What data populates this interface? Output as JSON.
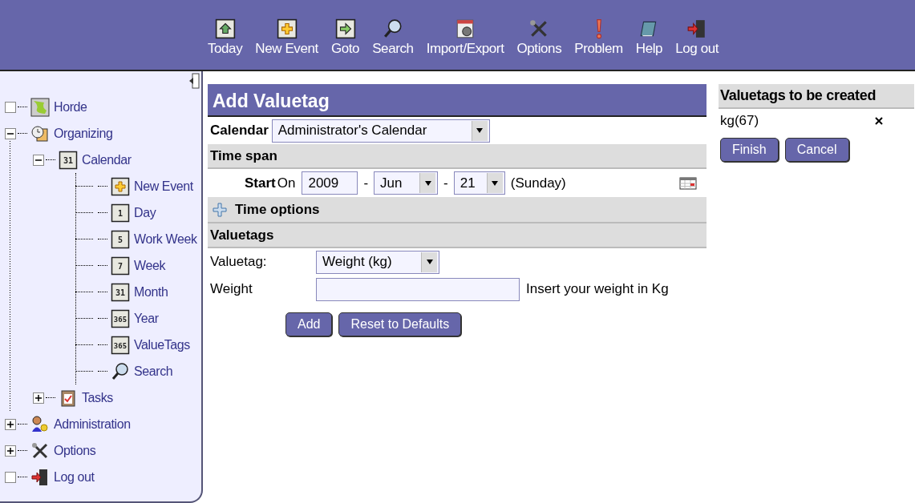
{
  "toolbar": [
    {
      "label": "Today",
      "kind": "today"
    },
    {
      "label": "New Event",
      "kind": "new"
    },
    {
      "label": "Goto",
      "kind": "goto"
    },
    {
      "label": "Search",
      "kind": "search"
    },
    {
      "label": "Import/Export",
      "kind": "import"
    },
    {
      "label": "Options",
      "kind": "options"
    },
    {
      "label": "Problem",
      "kind": "problem"
    },
    {
      "label": "Help",
      "kind": "help"
    },
    {
      "label": "Log out",
      "kind": "logout"
    }
  ],
  "sidebar": {
    "items": [
      {
        "label": "Horde",
        "kind": "horde"
      },
      {
        "label": "Organizing",
        "kind": "organizing",
        "expanded": true,
        "children": [
          {
            "label": "Calendar",
            "kind": "calendar",
            "icon_text": "31",
            "expanded": true,
            "children": [
              {
                "label": "New Event",
                "kind": "new"
              },
              {
                "label": "Day",
                "kind": "calendar",
                "icon_text": "1"
              },
              {
                "label": "Work Week",
                "kind": "calendar",
                "icon_text": "5"
              },
              {
                "label": "Week",
                "kind": "calendar",
                "icon_text": "7"
              },
              {
                "label": "Month",
                "kind": "calendar",
                "icon_text": "31"
              },
              {
                "label": "Year",
                "kind": "calendar",
                "icon_text": "365"
              },
              {
                "label": "ValueTags",
                "kind": "calendar",
                "icon_text": "365"
              },
              {
                "label": "Search",
                "kind": "search"
              }
            ]
          },
          {
            "label": "Tasks",
            "kind": "tasks",
            "expanded": false
          }
        ]
      },
      {
        "label": "Administration",
        "kind": "admin",
        "expanded": false
      },
      {
        "label": "Options",
        "kind": "options",
        "expanded": false
      },
      {
        "label": "Log out",
        "kind": "logout"
      }
    ]
  },
  "form": {
    "title": "Add Valuetag",
    "calendar": {
      "label": "Calendar",
      "value": "Administrator's Calendar"
    },
    "time_span": {
      "title": "Time span",
      "start_label": "Start",
      "on_label": "On",
      "year": "2009",
      "separator_1": "-",
      "month": "Jun",
      "separator_2": "-",
      "day": "21",
      "weekday": "(Sunday)"
    },
    "time_options": {
      "title": "Time options",
      "expanded": false
    },
    "valuetags": {
      "title": "Valuetags",
      "valuetag_label": "Valuetag:",
      "valuetag_value": "Weight (kg)",
      "weight_label": "Weight",
      "weight_hint": "Insert your weight in Kg"
    },
    "buttons": [
      "Add",
      "Reset to Defaults"
    ]
  },
  "pending": {
    "title": "Valuetags to be created",
    "items": [
      {
        "label": "kg(67)"
      }
    ],
    "buttons": [
      "Finish",
      "Cancel"
    ]
  }
}
